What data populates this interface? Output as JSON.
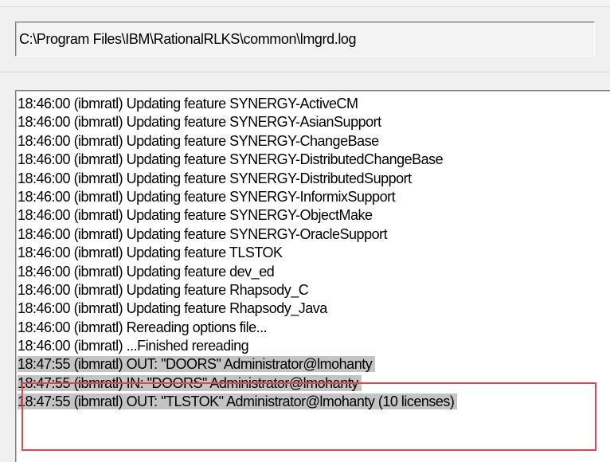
{
  "path_field": {
    "value": "C:\\Program Files\\IBM\\RationalRLKS\\common\\lmgrd.log"
  },
  "log": {
    "lines": [
      "18:46:00 (ibmratl) Updating feature SYNERGY-ActiveCM",
      "18:46:00 (ibmratl) Updating feature SYNERGY-AsianSupport",
      "18:46:00 (ibmratl) Updating feature SYNERGY-ChangeBase",
      "18:46:00 (ibmratl) Updating feature SYNERGY-DistributedChangeBase",
      "18:46:00 (ibmratl) Updating feature SYNERGY-DistributedSupport",
      "18:46:00 (ibmratl) Updating feature SYNERGY-InformixSupport",
      "18:46:00 (ibmratl) Updating feature SYNERGY-ObjectMake",
      "18:46:00 (ibmratl) Updating feature SYNERGY-OracleSupport",
      "18:46:00 (ibmratl) Updating feature TLSTOK",
      "18:46:00 (ibmratl) Updating feature dev_ed",
      "18:46:00 (ibmratl) Updating feature Rhapsody_C",
      "18:46:00 (ibmratl) Updating feature Rhapsody_Java",
      "18:46:00 (ibmratl) Rereading options file...",
      "18:46:00 (ibmratl) ...Finished rereading",
      "18:47:55 (ibmratl) OUT: \"DOORS\" Administrator@lmohanty",
      "18:47:55 (ibmratl) IN: \"DOORS\" Administrator@lmohanty",
      "18:47:55 (ibmratl) OUT: \"TLSTOK\" Administrator@lmohanty  (10 licenses)"
    ]
  },
  "colors": {
    "highlight_border": "#e0464f",
    "selection_background": "#c4c4c4"
  }
}
